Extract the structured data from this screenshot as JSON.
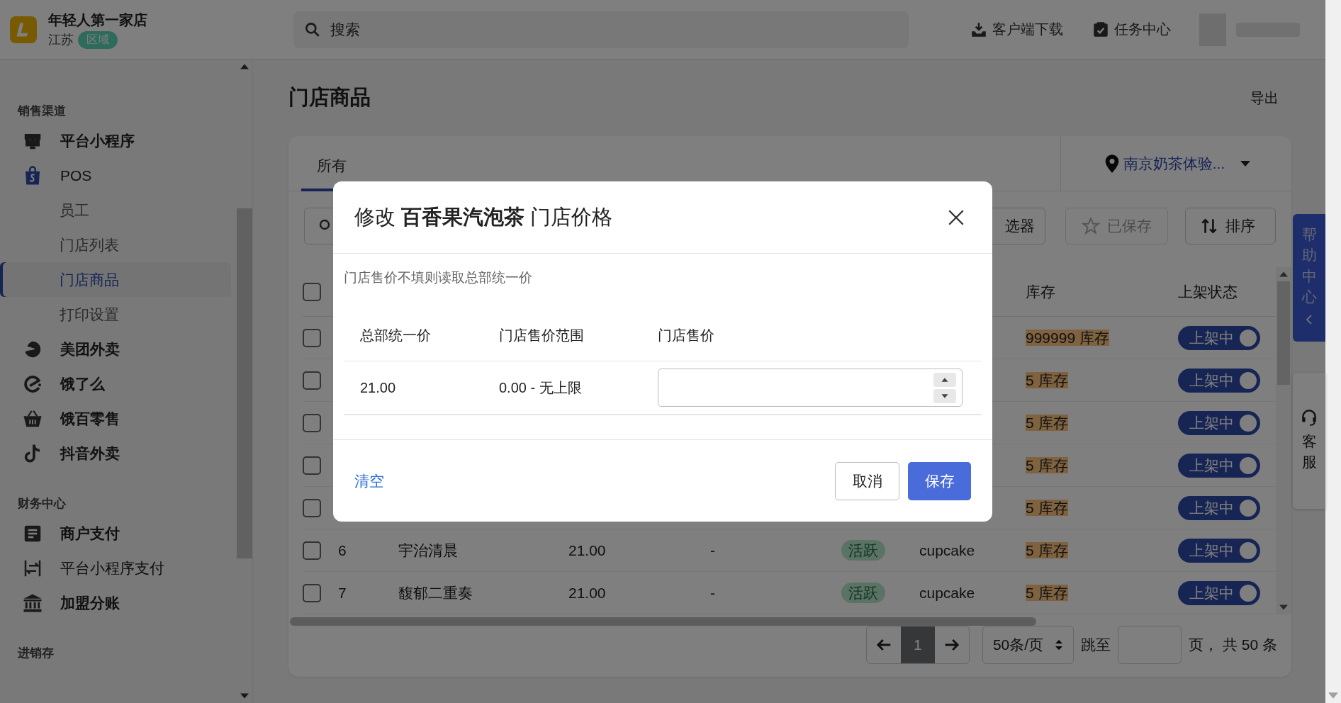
{
  "header": {
    "store_name": "年轻人第一家店",
    "region": "江苏",
    "region_badge": "区域",
    "search": {
      "placeholder": "搜索"
    },
    "actions": [
      {
        "label": "客户端下载"
      },
      {
        "label": "任务中心"
      }
    ]
  },
  "sidebar": {
    "sections": [
      {
        "title": "销售渠道",
        "items": [
          {
            "label": "平台小程序",
            "selected": false
          },
          {
            "label": "POS",
            "selected": false,
            "children": [
              {
                "label": "员工",
                "selected": false
              },
              {
                "label": "门店列表",
                "selected": false
              },
              {
                "label": "门店商品",
                "selected": true
              },
              {
                "label": "打印设置",
                "selected": false
              }
            ]
          },
          {
            "label": "美团外卖",
            "selected": false
          },
          {
            "label": "饿了么",
            "selected": false
          },
          {
            "label": "饿百零售",
            "selected": false
          },
          {
            "label": "抖音外卖",
            "selected": false
          }
        ]
      },
      {
        "title": "财务中心",
        "items": [
          {
            "label": "商户支付",
            "selected": false
          },
          {
            "label": "平台小程序支付",
            "selected": false
          },
          {
            "label": "加盟分账",
            "selected": false
          }
        ]
      },
      {
        "title": "进销存"
      }
    ]
  },
  "page": {
    "title": "门店商品",
    "export": "导出"
  },
  "tabs": [
    {
      "label": "所有",
      "selected": true
    }
  ],
  "location": "南京奶茶体验...",
  "toolbar": {
    "filter": "选器",
    "saved": "已保存",
    "sort": "排序"
  },
  "table": {
    "header": {
      "checked": false,
      "stock": "库存",
      "status": "上架状态"
    },
    "rows": [
      {
        "checked": false,
        "stock": "999999 库存",
        "status": {
          "label": "上架中",
          "on": true
        }
      },
      {
        "checked": false,
        "stock": "5 库存",
        "status": {
          "label": "上架中",
          "on": true
        }
      },
      {
        "checked": false,
        "stock": "5 库存",
        "status": {
          "label": "上架中",
          "on": true
        }
      },
      {
        "checked": false,
        "stock": "5 库存",
        "status": {
          "label": "上架中",
          "on": true
        }
      },
      {
        "checked": false,
        "stock": "5 库存",
        "status": {
          "label": "上架中",
          "on": true
        }
      },
      {
        "checked": false,
        "index": "6",
        "name": "宇治清晨",
        "price": "21.00",
        "column_5": "-",
        "tag": "活跃",
        "category": "cupcake",
        "stock": "5 库存",
        "status": {
          "label": "上架中",
          "on": true
        }
      },
      {
        "checked": false,
        "index": "7",
        "name": "馥郁二重奏",
        "price": "21.00",
        "column_5": "-",
        "tag": "活跃",
        "category": "cupcake",
        "stock": "5 库存",
        "status": {
          "label": "上架中",
          "on": true
        }
      }
    ]
  },
  "pagination": {
    "pages": [
      {
        "label": "1",
        "selected": true
      }
    ],
    "page_size": "50条/页",
    "jump_label": "跳至",
    "total": "页， 共 50 条"
  },
  "side_tabs": {
    "help": "帮助中心",
    "service": "客服"
  },
  "dialog": {
    "title": "修改 **百香果汽泡茶** 门店价格",
    "hint": "门店售价不填则读取总部统一价",
    "columns": [
      "总部统一价",
      "门店售价范围",
      "门店售价"
    ],
    "row": {
      "hq_price": "21.00",
      "range": "0.00 - 无上限"
    },
    "clear": "清空",
    "cancel": "取消",
    "save": "保存"
  }
}
